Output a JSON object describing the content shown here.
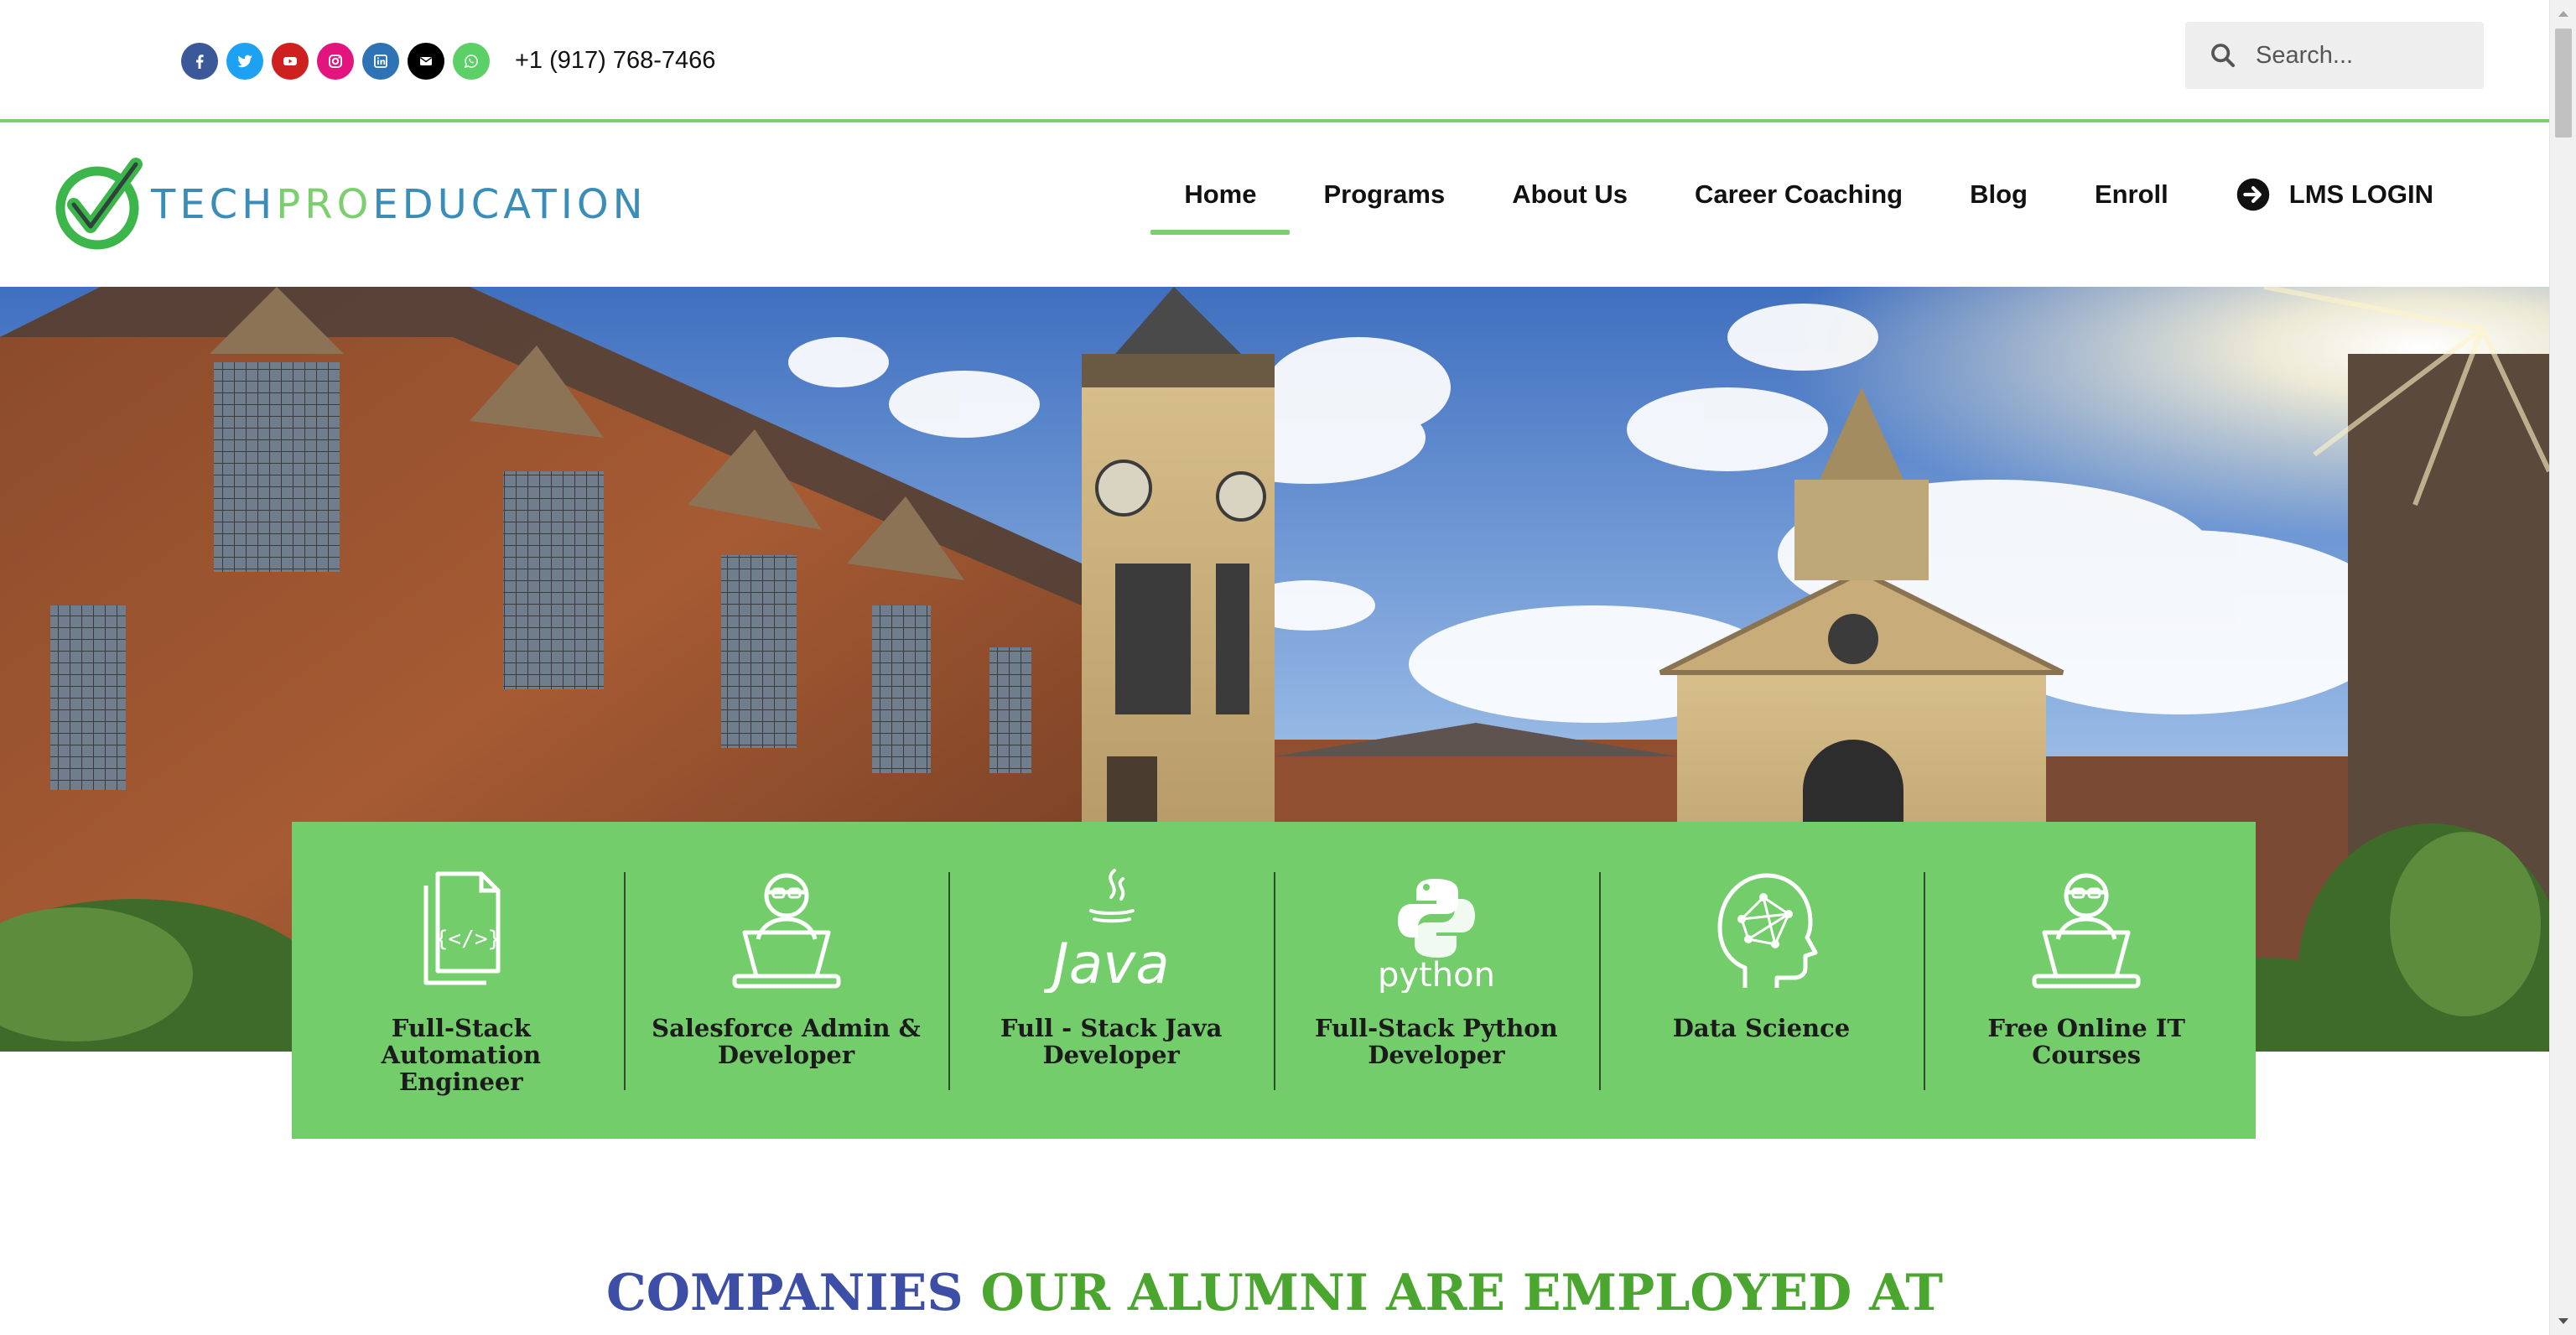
{
  "topbar": {
    "socials": [
      {
        "name": "facebook-icon",
        "color": "#3b5998"
      },
      {
        "name": "twitter-icon",
        "color": "#1da1f2"
      },
      {
        "name": "youtube-icon",
        "color": "#cd201f"
      },
      {
        "name": "instagram-icon",
        "color": "#e4147f"
      },
      {
        "name": "linkedin-icon",
        "color": "#2e74b5"
      },
      {
        "name": "envelope-icon",
        "color": "#000000"
      },
      {
        "name": "whatsapp-icon",
        "color": "#5bd066"
      }
    ],
    "phone": "+1 (917) 768-7466",
    "search_placeholder": "Search..."
  },
  "header": {
    "logo": {
      "part1": "TECH",
      "part2": "PRO",
      "part3": "EDUCATION"
    },
    "nav": [
      {
        "label": "Home",
        "active": true
      },
      {
        "label": "Programs"
      },
      {
        "label": "About Us"
      },
      {
        "label": "Career Coaching"
      },
      {
        "label": "Blog"
      },
      {
        "label": "Enroll"
      }
    ],
    "lms_label": "LMS LOGIN"
  },
  "programs": [
    {
      "label": "Full-Stack Automation Engineer",
      "icon": "code-documents-icon"
    },
    {
      "label": "Salesforce Admin & Developer",
      "icon": "developer-laptop-icon"
    },
    {
      "label": "Full - Stack Java Developer",
      "icon": "java-logo-icon"
    },
    {
      "label": "Full-Stack Python Developer",
      "icon": "python-logo-icon"
    },
    {
      "label": "Data Science",
      "icon": "brain-network-icon"
    },
    {
      "label": "Free Online IT Courses",
      "icon": "developer-laptop-icon"
    }
  ],
  "companies_heading": {
    "part1": "COMPANIES",
    "part2": "OUR ALUMNI ARE EMPLOYED AT"
  },
  "colors": {
    "brand_green": "#74cd6b",
    "brand_blue": "#3a8db8",
    "heading_blue": "#3d4ea6",
    "heading_green": "#4aa62e"
  }
}
